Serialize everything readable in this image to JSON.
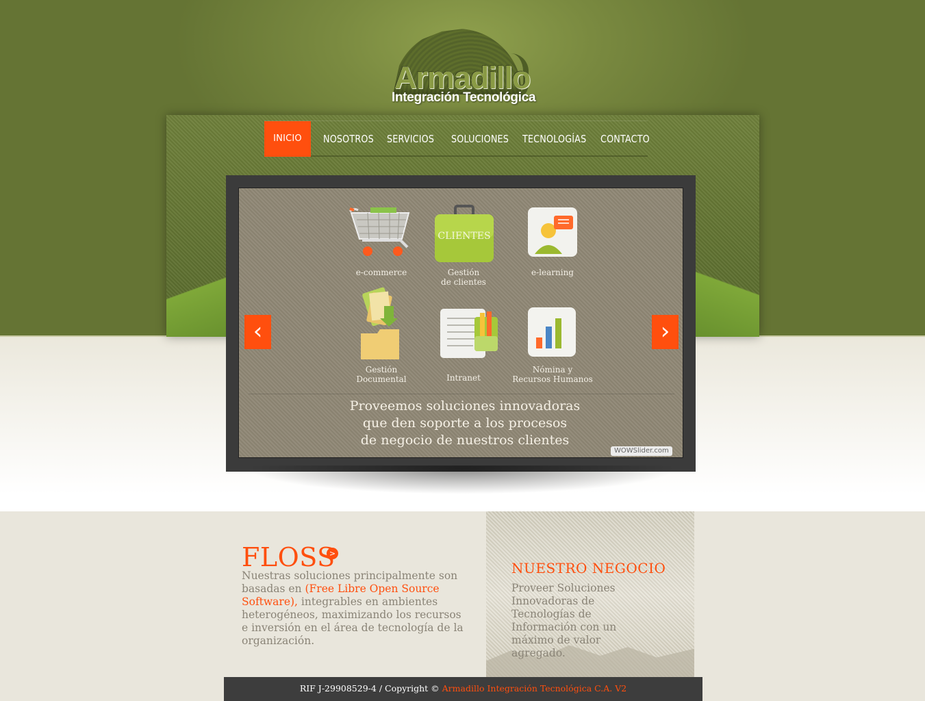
{
  "brand": {
    "logo_title": "Armadillo",
    "logo_subtitle": "Integración Tecnológica"
  },
  "nav": {
    "items": [
      {
        "label": "INICIO",
        "active": true
      },
      {
        "label": "NOSOTROS",
        "active": false
      },
      {
        "label": "SERVICIOS",
        "active": false
      },
      {
        "label": "SOLUCIONES",
        "active": false
      },
      {
        "label": "TECNOLOGÍAS",
        "active": false
      },
      {
        "label": "CONTACTO",
        "active": false
      }
    ]
  },
  "slider": {
    "items": [
      {
        "label": "e-commerce",
        "icon": "shopping-cart-icon"
      },
      {
        "label": "Gestión\nde clientes",
        "icon": "briefcase-icon",
        "icon_text": "CLIENTES"
      },
      {
        "label": "e-learning",
        "icon": "user-chat-icon"
      },
      {
        "label": "Gestión\nDocumental",
        "icon": "folder-documents-icon"
      },
      {
        "label": "Intranet",
        "icon": "document-pencil-icon"
      },
      {
        "label": "Nómina y\nRecursos Humanos",
        "icon": "bar-chart-icon"
      }
    ],
    "caption": "Proveemos soluciones innovadoras\nque den soporte a los procesos\nde negocio de nuestros clientes",
    "badge": "WOWSlider.com",
    "prev_arrow": "‹",
    "next_arrow": "›"
  },
  "floss": {
    "title": "FLOSS",
    "badge": ">",
    "text_before": "Nuestras soluciones principalmente son basadas en ",
    "highlight": "(Free Libre Open Source Software),",
    "text_after": " integrables en ambientes heterogéneos, maximizando los recursos e inversión en el área de tecnología de la organización."
  },
  "negocio": {
    "title": "NUESTRO NEGOCIO",
    "text": "Proveer Soluciones Innovadoras de Tecnologías de Información con un máximo de valor agregado."
  },
  "footer": {
    "text": "RIF J-29908529-4 / Copyright © ",
    "company": "Armadillo Integración Tecnológica C.A. V2"
  },
  "colors": {
    "accent": "#ff4f0e",
    "header_green": "#7a8a40",
    "footer_bg": "#3d3d3d"
  }
}
